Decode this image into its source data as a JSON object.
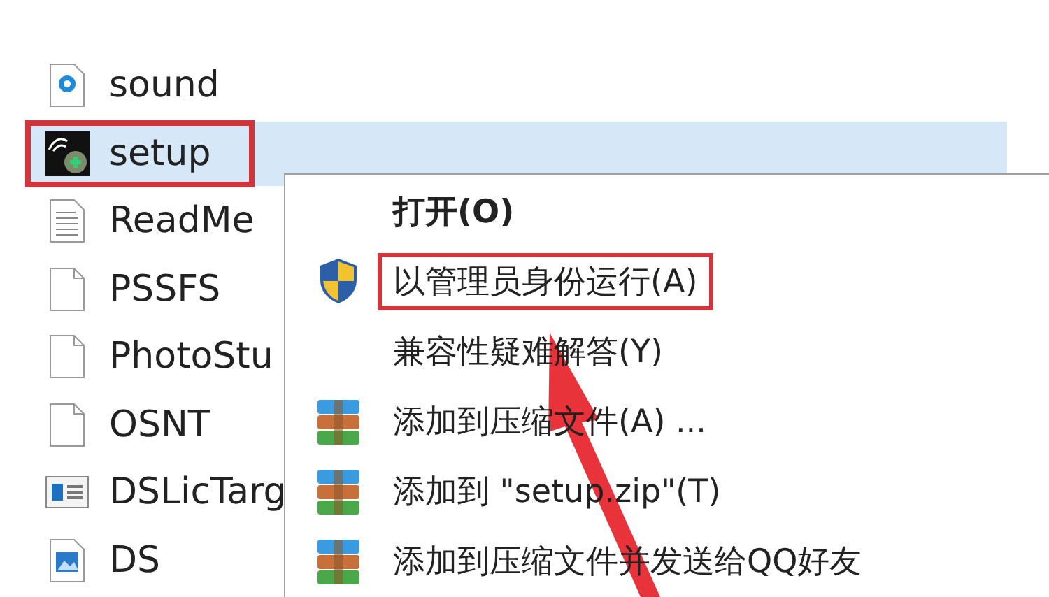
{
  "files": [
    {
      "name": "sound",
      "kind": "audio",
      "selected": false,
      "outlined": false
    },
    {
      "name": "setup",
      "kind": "installer",
      "selected": true,
      "outlined": true
    },
    {
      "name": "ReadMe",
      "kind": "text",
      "selected": false,
      "outlined": false
    },
    {
      "name": "PSSFS",
      "kind": "blank",
      "selected": false,
      "outlined": false
    },
    {
      "name": "PhotoStu",
      "kind": "blank",
      "selected": false,
      "outlined": false
    },
    {
      "name": "OSNT",
      "kind": "blank",
      "selected": false,
      "outlined": false
    },
    {
      "name": "DSLicTarg",
      "kind": "config",
      "selected": false,
      "outlined": false
    },
    {
      "name": "DS",
      "kind": "image",
      "selected": false,
      "outlined": false
    }
  ],
  "context_menu": [
    {
      "label": "打开(O)",
      "kind": "plain",
      "bold": true,
      "outlined": false
    },
    {
      "label": "以管理员身份运行(A)",
      "kind": "shield",
      "bold": false,
      "outlined": true
    },
    {
      "label": "兼容性疑难解答(Y)",
      "kind": "plain",
      "bold": false,
      "outlined": false
    },
    {
      "label": "添加到压缩文件(A) ...",
      "kind": "archive",
      "bold": false,
      "outlined": false
    },
    {
      "label": "添加到 \"setup.zip\"(T)",
      "kind": "archive",
      "bold": false,
      "outlined": false
    },
    {
      "label": "添加到压缩文件并发送给QQ好友",
      "kind": "archive",
      "bold": false,
      "outlined": false
    }
  ]
}
